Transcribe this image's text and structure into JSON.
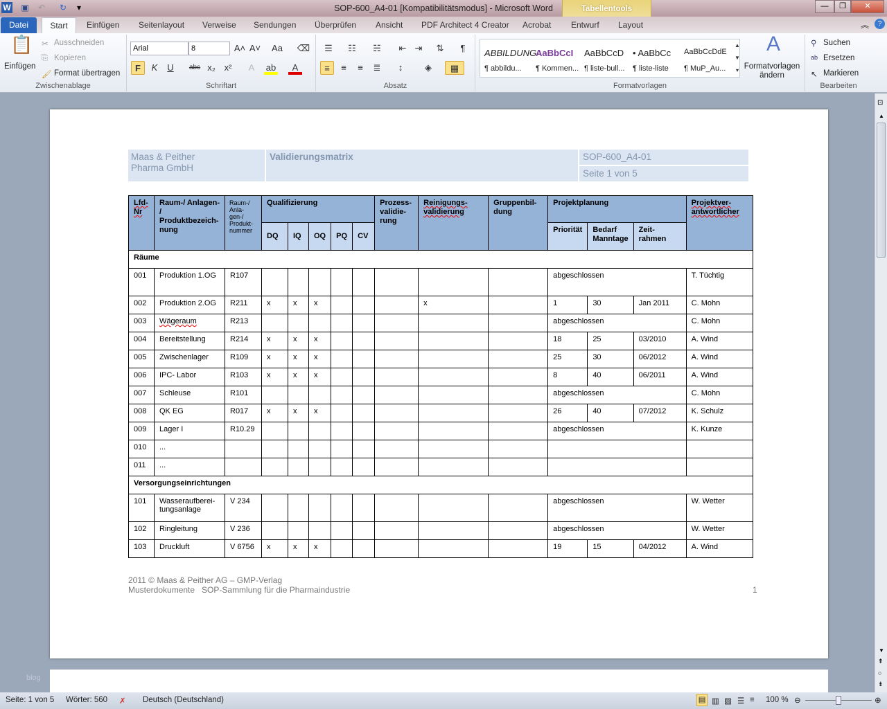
{
  "window": {
    "title": "SOP-600_A4-01 [Kompatibilitätsmodus] - Microsoft Word",
    "context_tab": "Tabellentools",
    "minimize": "—",
    "maximize": "❐",
    "close": "✕"
  },
  "tabs": [
    "Datei",
    "Start",
    "Einfügen",
    "Seitenlayout",
    "Verweise",
    "Sendungen",
    "Überprüfen",
    "Ansicht",
    "PDF Architect 4 Creator",
    "Acrobat",
    "Entwurf",
    "Layout"
  ],
  "ribbon": {
    "clipboard": {
      "label": "Zwischenablage",
      "paste": "Einfügen",
      "cut": "Ausschneiden",
      "copy": "Kopieren",
      "format": "Format übertragen"
    },
    "font": {
      "label": "Schriftart",
      "name": "Arial",
      "size": "8"
    },
    "paragraph": {
      "label": "Absatz"
    },
    "styles": {
      "label": "Formatvorlagen",
      "change": "Formatvorlagen ändern",
      "items": [
        {
          "preview": "ABBILDUNG",
          "name": "¶ abbildu..."
        },
        {
          "preview": "AaBbCcI",
          "name": "¶ Kommen..."
        },
        {
          "preview": "AaBbCcD",
          "name": "¶ liste-bull..."
        },
        {
          "preview": "• AaBbCc",
          "name": "¶ liste-liste"
        },
        {
          "preview": "AaBbCcDdE",
          "name": "¶ MuP_Au..."
        }
      ]
    },
    "editing": {
      "label": "Bearbeiten",
      "find": "Suchen",
      "replace": "Ersetzen",
      "select": "Markieren"
    }
  },
  "doc": {
    "header": {
      "company1": "Maas & Peither",
      "company2": "Pharma GmbH",
      "title": "Validierungsmatrix",
      "sop": "SOP-600_A4-01",
      "page": "Seite 1 von 5"
    },
    "columns": {
      "lfd": "Lfd-Nr",
      "raum": "Raum-/ Anlagen- / Produktbezeich-nung",
      "nummer": "Raum-/ Anla-gen-/ Produkt-nummer",
      "qual": "Qualifizierung",
      "dq": "DQ",
      "iq": "IQ",
      "oq": "OQ",
      "pq": "PQ",
      "cv": "CV",
      "prozess": "Prozess-validie-rung",
      "reinigung": "Reinigungs-validierung",
      "gruppen": "Gruppenbil-dung",
      "projekt": "Projektplanung",
      "prio": "Priorität",
      "bedarf": "Bedarf Manntage",
      "zeit": "Zeit-rahmen",
      "verantw": "Projektver-antwortlicher"
    },
    "rows": [
      {
        "section": "Räume"
      },
      {
        "nr": "001",
        "name": "Produktion 1.OG",
        "num": "R107",
        "q": [
          "",
          "",
          "",
          "",
          ""
        ],
        "pv": "",
        "rv": "",
        "gb": "",
        "status": "abgeschlossen",
        "resp": "T. Tüchtig",
        "tall": true
      },
      {
        "nr": "002",
        "name": "Produktion 2.OG",
        "num": "R211",
        "q": [
          "x",
          "x",
          "x",
          "",
          ""
        ],
        "pv": "",
        "rv": "x",
        "gb": "",
        "prio": "1",
        "bedarf": "30",
        "zeit": "Jan 2011",
        "resp": "C. Mohn"
      },
      {
        "nr": "003",
        "name": "Wägeraum",
        "num": "R213",
        "q": [
          "",
          "",
          "",
          "",
          ""
        ],
        "pv": "",
        "rv": "",
        "gb": "",
        "status": "abgeschlossen",
        "resp": "C. Mohn"
      },
      {
        "nr": "004",
        "name": "Bereitstellung",
        "num": "R214",
        "q": [
          "x",
          "x",
          "x",
          "",
          ""
        ],
        "pv": "",
        "rv": "",
        "gb": "",
        "prio": "18",
        "bedarf": "25",
        "zeit": "03/2010",
        "resp": "A. Wind"
      },
      {
        "nr": "005",
        "name": "Zwischenlager",
        "num": "R109",
        "q": [
          "x",
          "x",
          "x",
          "",
          ""
        ],
        "pv": "",
        "rv": "",
        "gb": "",
        "prio": "25",
        "bedarf": "30",
        "zeit": "06/2012",
        "resp": "A. Wind"
      },
      {
        "nr": "006",
        "name": "IPC- Labor",
        "num": "R103",
        "q": [
          "x",
          "x",
          "x",
          "",
          ""
        ],
        "pv": "",
        "rv": "",
        "gb": "",
        "prio": "8",
        "bedarf": "40",
        "zeit": "06/2011",
        "resp": "A. Wind"
      },
      {
        "nr": "007",
        "name": "Schleuse",
        "num": "R101",
        "q": [
          "",
          "",
          "",
          "",
          ""
        ],
        "pv": "",
        "rv": "",
        "gb": "",
        "status": "abgeschlossen",
        "resp": "C. Mohn"
      },
      {
        "nr": "008",
        "name": "QK EG",
        "num": "R017",
        "q": [
          "x",
          "x",
          "x",
          "",
          ""
        ],
        "pv": "",
        "rv": "",
        "gb": "",
        "prio": "26",
        "bedarf": "40",
        "zeit": "07/2012",
        "resp": "K. Schulz"
      },
      {
        "nr": "009",
        "name": "Lager I",
        "num": "R10.29",
        "q": [
          "",
          "",
          "",
          "",
          ""
        ],
        "pv": "",
        "rv": "",
        "gb": "",
        "status": "abgeschlossen",
        "resp": "K. Kunze"
      },
      {
        "nr": "010",
        "name": "...",
        "num": "",
        "q": [
          "",
          "",
          "",
          "",
          ""
        ],
        "pv": "",
        "rv": "",
        "gb": "",
        "status": "",
        "resp": ""
      },
      {
        "nr": "011",
        "name": "...",
        "num": "",
        "q": [
          "",
          "",
          "",
          "",
          ""
        ],
        "pv": "",
        "rv": "",
        "gb": "",
        "status": "",
        "resp": ""
      },
      {
        "section": "Versorgungseinrichtungen"
      },
      {
        "nr": "101",
        "name": "Wasseraufberei-tungsanlage",
        "num": "V 234",
        "q": [
          "",
          "",
          "",
          "",
          ""
        ],
        "pv": "",
        "rv": "",
        "gb": "",
        "status": "abgeschlossen",
        "resp": "W. Wetter",
        "tall": true
      },
      {
        "nr": "102",
        "name": "Ringleitung",
        "num": "V 236",
        "q": [
          "",
          "",
          "",
          "",
          ""
        ],
        "pv": "",
        "rv": "",
        "gb": "",
        "status": "abgeschlossen",
        "resp": "W. Wetter"
      },
      {
        "nr": "103",
        "name": "Druckluft",
        "num": "V 6756",
        "q": [
          "x",
          "x",
          "x",
          "",
          ""
        ],
        "pv": "",
        "rv": "",
        "gb": "",
        "prio": "19",
        "bedarf": "15",
        "zeit": "04/2012",
        "resp": "A. Wind"
      }
    ],
    "footer": {
      "line1": "2011 © Maas & Peither AG – GMP-Verlag",
      "line2": "Musterdokumente   SOP-Sammlung für die Pharmaindustrie",
      "page_number": "1"
    },
    "watermark": "blog"
  },
  "status": {
    "page": "Seite: 1 von 5",
    "words": "Wörter: 560",
    "language": "Deutsch (Deutschland)",
    "zoom": "100 %",
    "zoom_percent": 100
  }
}
